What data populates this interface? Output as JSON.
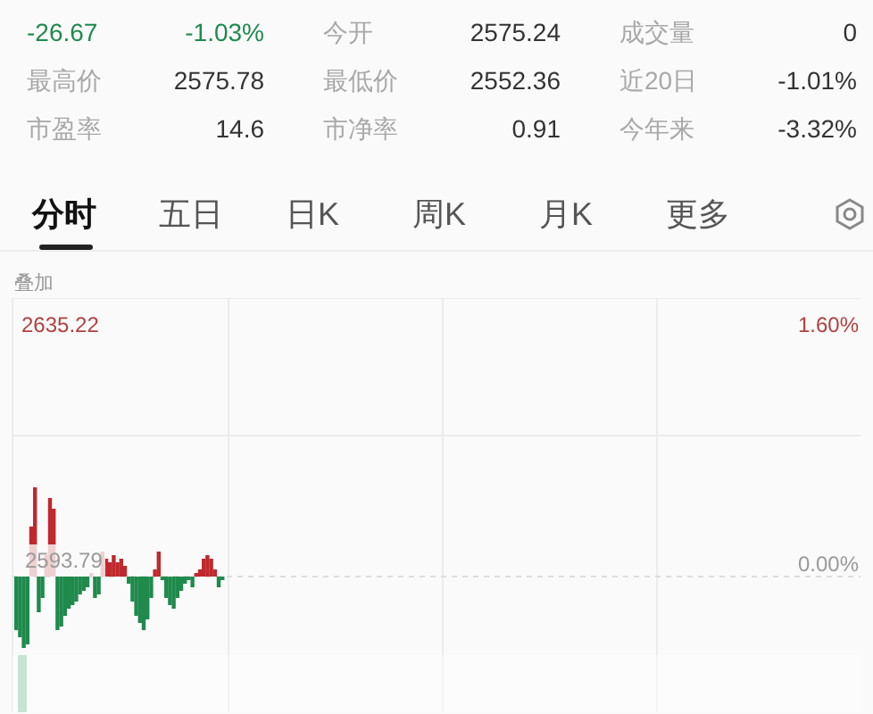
{
  "stats": [
    [
      {
        "text": "-26.67",
        "kind": "down"
      },
      {
        "text": "-1.03%",
        "kind": "down"
      },
      {
        "text": "今开",
        "kind": "label"
      },
      {
        "text": "2575.24",
        "kind": "value"
      },
      {
        "text": "成交量",
        "kind": "label"
      },
      {
        "text": "0",
        "kind": "value"
      }
    ],
    [
      {
        "text": "最高价",
        "kind": "label"
      },
      {
        "text": "2575.78",
        "kind": "value"
      },
      {
        "text": "最低价",
        "kind": "label"
      },
      {
        "text": "2552.36",
        "kind": "value"
      },
      {
        "text": "近20日",
        "kind": "label"
      },
      {
        "text": "-1.01%",
        "kind": "value"
      }
    ],
    [
      {
        "text": "市盈率",
        "kind": "label"
      },
      {
        "text": "14.6",
        "kind": "value"
      },
      {
        "text": "市净率",
        "kind": "label"
      },
      {
        "text": "0.91",
        "kind": "value"
      },
      {
        "text": "今年来",
        "kind": "label"
      },
      {
        "text": "-3.32%",
        "kind": "value"
      }
    ]
  ],
  "tabs": [
    {
      "label": "分时",
      "selected": true
    },
    {
      "label": "五日",
      "selected": false
    },
    {
      "label": "日K",
      "selected": false
    },
    {
      "label": "周K",
      "selected": false
    },
    {
      "label": "月K",
      "selected": false
    },
    {
      "label": "更多",
      "selected": false
    }
  ],
  "overlay_label": "叠加",
  "chart": {
    "high_price": "2635.22",
    "high_pct": "1.60%",
    "base_price": "2593.79",
    "base_pct": "0.00%"
  }
}
